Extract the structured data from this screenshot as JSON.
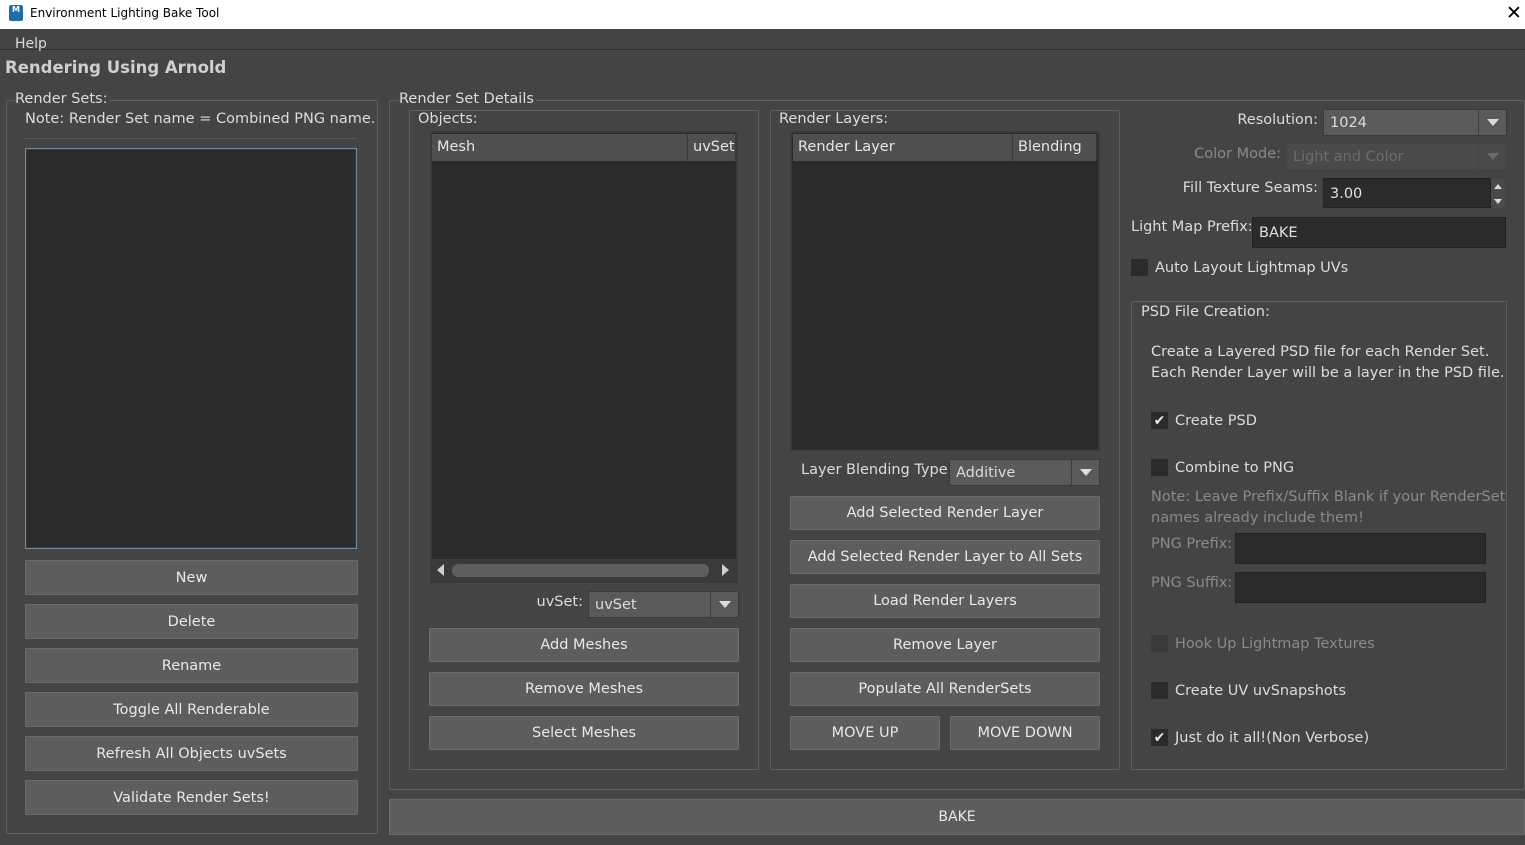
{
  "window": {
    "title": "Environment Lighting Bake Tool",
    "app_icon_glyph": "M",
    "close_glyph": "✕"
  },
  "menu": {
    "help": "Help"
  },
  "main_title": "Rendering Using Arnold",
  "render_sets": {
    "group_label": "Render Sets:",
    "note": "Note: Render Set name = Combined PNG name.",
    "items": [],
    "buttons": {
      "new": "New",
      "delete": "Delete",
      "rename": "Rename",
      "toggle_all": "Toggle All Renderable",
      "refresh_uvsets": "Refresh All Objects uvSets",
      "validate": "Validate Render Sets!"
    }
  },
  "details": {
    "group_label": "Render Set Details",
    "objects": {
      "label": "Objects:",
      "columns": [
        "Mesh",
        "uvSet"
      ],
      "rows": [],
      "uvset_label": "uvSet:",
      "uvset_value": "uvSet",
      "buttons": {
        "add": "Add Meshes",
        "remove": "Remove Meshes",
        "select": "Select Meshes"
      }
    },
    "render_layers": {
      "label": "Render Layers:",
      "columns": [
        "Render Layer",
        "Blending"
      ],
      "rows": [],
      "blending_label": "Layer Blending Type:",
      "blending_value": "Additive",
      "buttons": {
        "add_selected": "Add Selected Render Layer",
        "add_to_all": "Add Selected Render Layer to All Sets",
        "load": "Load Render Layers",
        "remove": "Remove Layer",
        "populate": "Populate All RenderSets",
        "move_up": "MOVE UP",
        "move_down": "MOVE DOWN"
      }
    }
  },
  "settings": {
    "resolution_label": "Resolution:",
    "resolution_value": "1024",
    "color_mode_label": "Color Mode:",
    "color_mode_value": "Light and Color",
    "fill_seams_label": "Fill Texture Seams:",
    "fill_seams_value": "3.00",
    "prefix_label": "Light Map Prefix:",
    "prefix_value": "BAKE",
    "auto_layout_label": "Auto Layout Lightmap UVs",
    "auto_layout_checked": false
  },
  "psd": {
    "group_label": "PSD File Creation:",
    "desc_line1": "Create a Layered PSD file for each Render Set.",
    "desc_line2": "Each Render Layer will be a layer in the PSD file.",
    "create_psd_label": "Create PSD",
    "create_psd_checked": true,
    "combine_png_label": "Combine to PNG",
    "combine_png_checked": false,
    "note_line1": "Note: Leave Prefix/Suffix Blank if your RenderSet",
    "note_line2": "names already include them!",
    "png_prefix_label": "PNG Prefix:",
    "png_prefix_value": "",
    "png_suffix_label": "PNG Suffix:",
    "png_suffix_value": "",
    "hookup_label": "Hook Up Lightmap Textures",
    "hookup_checked": false,
    "uv_snapshots_label": "Create UV uvSnapshots",
    "uv_snapshots_checked": false,
    "just_do_it_label": "Just do it all!(Non Verbose)",
    "just_do_it_checked": true,
    "check_glyph": "✔"
  },
  "bake_button": "BAKE",
  "colors": {
    "background": "#444444",
    "list_bg": "#2b2b2b",
    "button_bg": "#5d5d5d",
    "header_bg": "#4f4f4f",
    "focus_border": "#6e8aa0"
  }
}
